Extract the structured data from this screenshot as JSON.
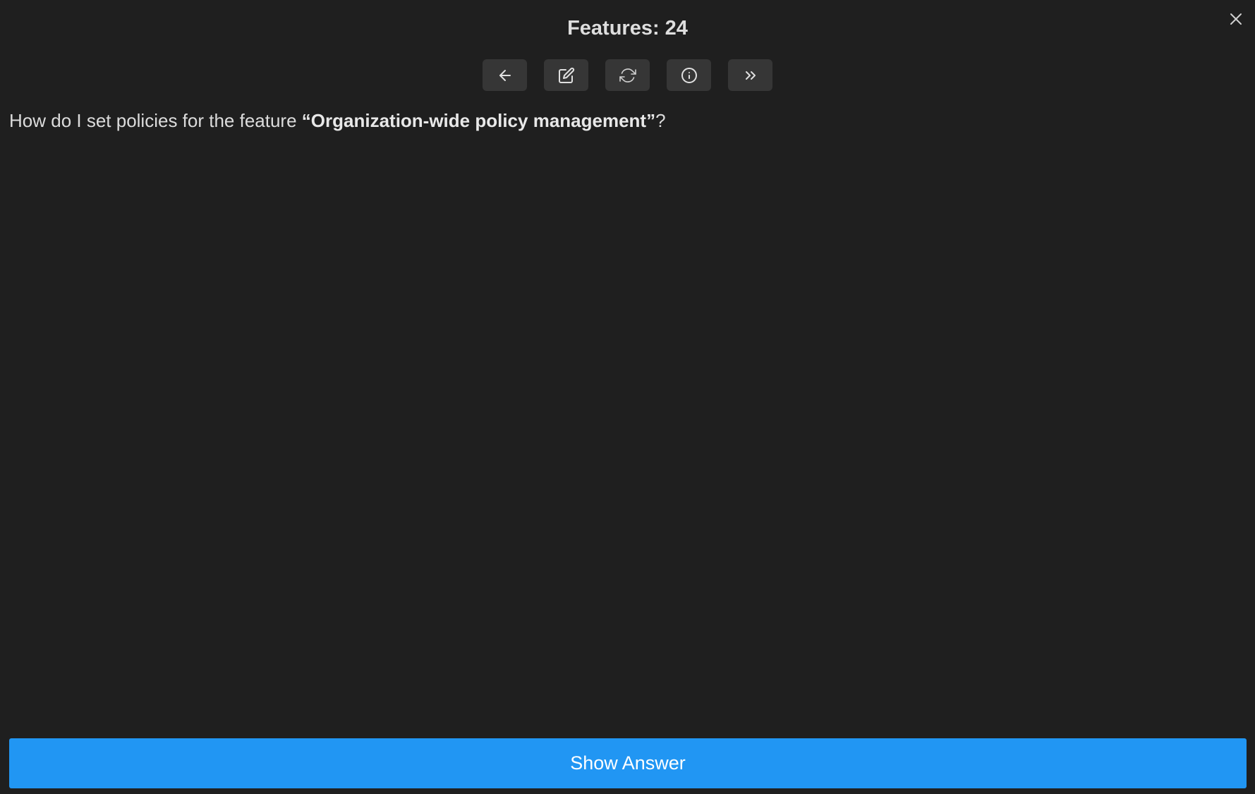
{
  "header": {
    "title": "Features: 24"
  },
  "toolbar": {
    "buttons": [
      {
        "icon": "arrow-left-icon"
      },
      {
        "icon": "edit-icon"
      },
      {
        "icon": "refresh-icon"
      },
      {
        "icon": "info-icon"
      },
      {
        "icon": "chevrons-right-icon"
      }
    ]
  },
  "card": {
    "question_prefix": "How do I set policies for the feature ",
    "question_highlight": "“Organization-wide policy management”",
    "question_suffix": "?"
  },
  "footer": {
    "show_answer_label": "Show Answer"
  },
  "colors": {
    "background": "#1f1f1f",
    "button_bg": "#363636",
    "accent": "#2196f3"
  }
}
